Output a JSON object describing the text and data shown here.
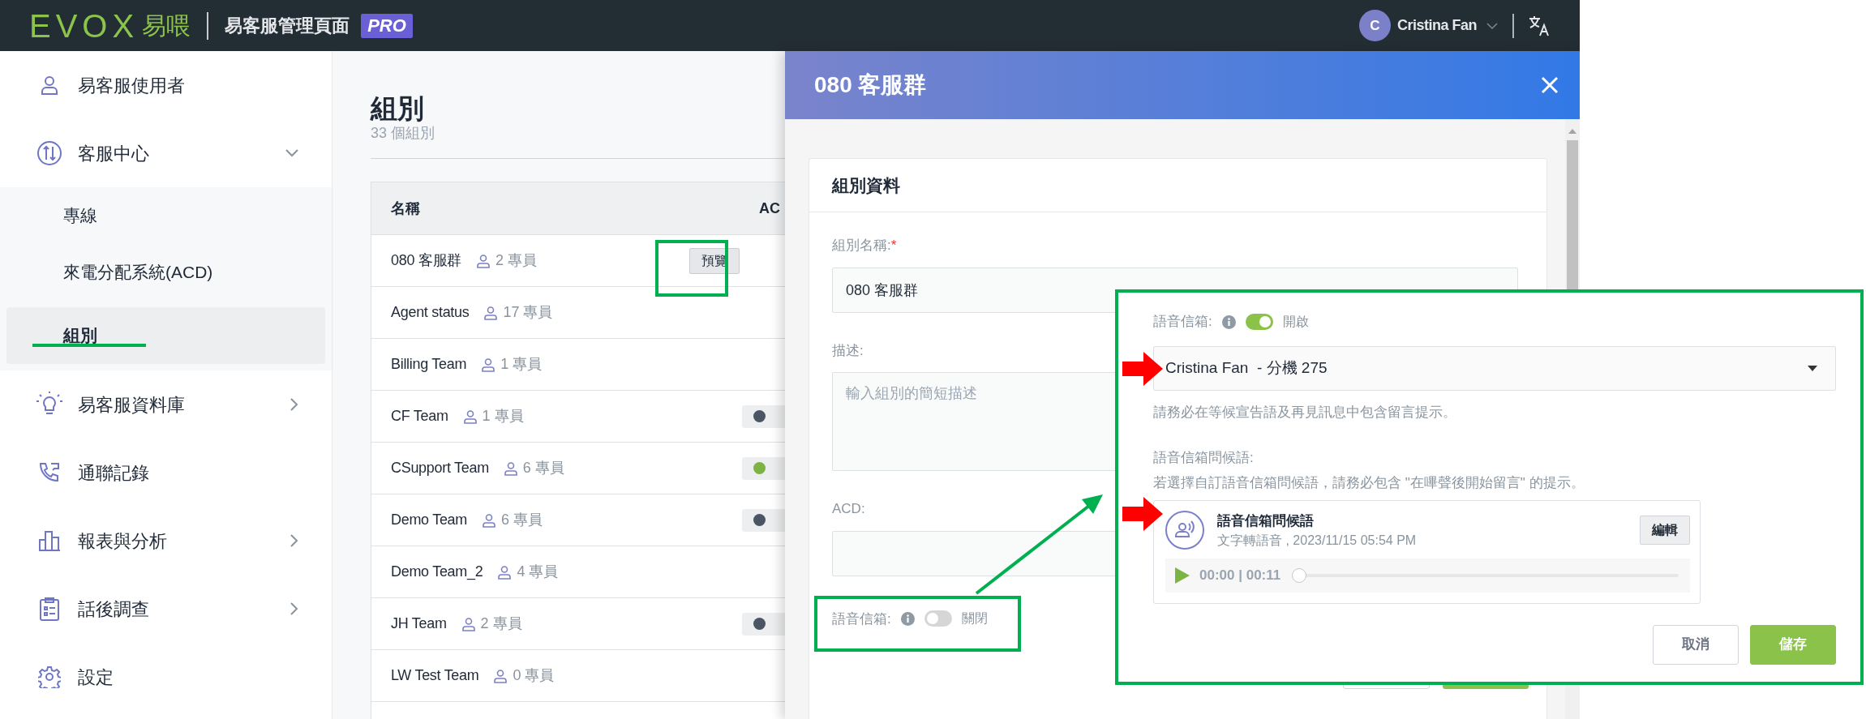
{
  "header": {
    "logo": "EVOX",
    "logo_suffix": "易喂",
    "title": "易客服管理頁面",
    "badge": "PRO",
    "user": {
      "initial": "C",
      "name": "Cristina Fan"
    }
  },
  "sidebar": {
    "items": [
      {
        "label": "易客服使用者",
        "selected": false
      },
      {
        "label": "客服中心",
        "selected": false,
        "expanded": true,
        "children": [
          {
            "label": "專線",
            "selected": false
          },
          {
            "label": "來電分配系統(ACD)",
            "selected": false
          },
          {
            "label": "組別",
            "selected": true
          }
        ]
      },
      {
        "label": "易客服資料庫",
        "selected": false,
        "expanded": false
      },
      {
        "label": "通聯記錄",
        "selected": false
      },
      {
        "label": "報表與分析",
        "selected": false,
        "expanded": false
      },
      {
        "label": "話後調查",
        "selected": false,
        "expanded": false
      },
      {
        "label": "設定",
        "selected": false
      }
    ]
  },
  "page": {
    "title": "組別",
    "subtitle": "33 個組別",
    "table": {
      "columns": [
        "名稱",
        "AC"
      ],
      "rows": [
        {
          "name": "080 客服群",
          "members": "2 專員",
          "action": "預覽"
        },
        {
          "name": "Agent status",
          "members": "17 專員"
        },
        {
          "name": "Billing Team",
          "members": "1 專員"
        },
        {
          "name": "CF Team",
          "members": "1 專員",
          "color": "#4b5563"
        },
        {
          "name": "CSupport Team",
          "members": "6 專員",
          "color": "#7cb342"
        },
        {
          "name": "Demo Team",
          "members": "6 專員",
          "color": "#4b5563"
        },
        {
          "name": "Demo Team_2",
          "members": "4 專員"
        },
        {
          "name": "JH Team",
          "members": "2 專員",
          "color": "#4b5563"
        },
        {
          "name": "LW Test Team",
          "members": "0 專員"
        }
      ]
    }
  },
  "dialog": {
    "title": "080 客服群",
    "section_title": "組別資料",
    "fields": [
      {
        "kind": "input",
        "label": "組別名稱:",
        "required_mark": "*",
        "value": "080 客服群"
      },
      {
        "kind": "textarea",
        "label": "描述:",
        "placeholder": "輸入組別的簡短描述"
      },
      {
        "kind": "input",
        "label": "ACD:"
      },
      {
        "kind": "switch",
        "label": "語音信箱:",
        "on": false,
        "state_text": "關閉"
      }
    ]
  },
  "callout": {
    "voicemail": {
      "label": "語音信箱:",
      "on": true,
      "state_text": "開啟"
    },
    "select": {
      "value": "Cristina Fan  - 分機 275"
    },
    "hint": "請務必在等候宣告語及再見訊息中包含留言提示。",
    "greeting_label": "語音信箱問候語:",
    "greeting_note": "若選擇自訂語音信箱問候語，請務必包含 \"在嗶聲後開始留言\" 的提示。",
    "greeting": {
      "title": "語音信箱問候語",
      "subtitle": "文字轉語音 , 2023/11/15 05:54 PM",
      "edit": "編輯",
      "time": "00:00 | 00:11",
      "level": 0
    },
    "buttons": [
      {
        "label": "取消",
        "kind": "secondary"
      },
      {
        "label": "儲存",
        "kind": "primary"
      }
    ]
  }
}
